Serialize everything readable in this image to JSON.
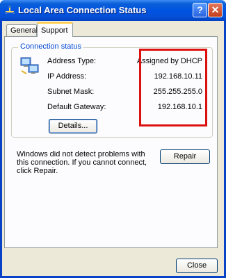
{
  "window": {
    "title": "Local Area Connection Status",
    "help_label": "?",
    "close_label": "✕"
  },
  "tabs": [
    {
      "label": "General"
    },
    {
      "label": "Support"
    }
  ],
  "connection_status": {
    "legend": "Connection status",
    "rows": [
      {
        "label": "Address Type:",
        "value": "Assigned by DHCP"
      },
      {
        "label": "IP Address:",
        "value": "192.168.10.11"
      },
      {
        "label": "Subnet Mask:",
        "value": "255.255.255.0"
      },
      {
        "label": "Default Gateway:",
        "value": "192.168.10.1"
      }
    ],
    "details_label": "Details..."
  },
  "troubleshoot": {
    "message": "Windows did not detect problems with this connection. If you cannot connect, click Repair.",
    "repair_label": "Repair"
  },
  "footer": {
    "close_label": "Close"
  },
  "colors": {
    "title_bar": "#0054e3",
    "highlight": "#dd1010",
    "legend_text": "#0046d5"
  }
}
